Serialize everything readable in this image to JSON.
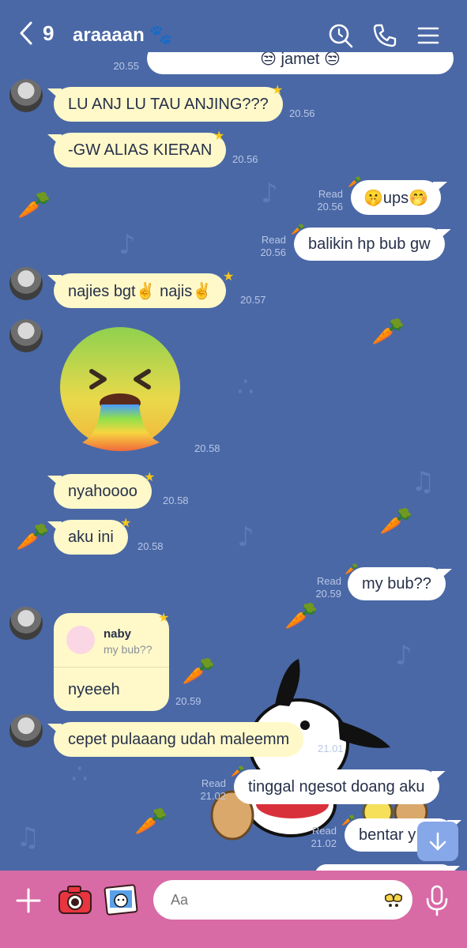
{
  "header": {
    "back_count": "9",
    "title": "araaaan",
    "title_emoji": "🐾"
  },
  "messages": [
    {
      "dir": "out",
      "text": "😒 jamet 😒",
      "time": "20.55",
      "partial": true
    },
    {
      "dir": "in",
      "text": "LU ANJ LU TAU ANJING???",
      "time": "20.56"
    },
    {
      "dir": "in",
      "text": "-GW ALIAS KIERAN",
      "time": "20.56"
    },
    {
      "dir": "out",
      "text": "🤫ups🤭",
      "read": "Read",
      "time": "20.56"
    },
    {
      "dir": "out",
      "text": "balikin hp bub gw",
      "read": "Read",
      "time": "20.56"
    },
    {
      "dir": "in",
      "text": "najies bgt✌️ najis✌️",
      "time": "20.57"
    },
    {
      "dir": "in",
      "type": "sticker",
      "sticker": "vomiting-face",
      "time": "20.58"
    },
    {
      "dir": "in",
      "text": "nyahoooo",
      "time": "20.58"
    },
    {
      "dir": "in",
      "text": "aku ini",
      "time": "20.58"
    },
    {
      "dir": "out",
      "text": "my bub??",
      "read": "Read",
      "time": "20.59"
    },
    {
      "dir": "in",
      "type": "reply",
      "quote_name": "naby",
      "quote_text": "my bub??",
      "text": "nyeeeh",
      "time": "20.59"
    },
    {
      "dir": "in",
      "text": "cepet pulaaang udah maleemm",
      "time": "21.01"
    },
    {
      "dir": "out",
      "text": "tinggal ngesot doang aku",
      "read": "Read",
      "time": "21.02"
    },
    {
      "dir": "out",
      "text": "bentar y",
      "read": "Read",
      "time": "21.02"
    }
  ],
  "composer": {
    "placeholder": "Aa"
  },
  "colors": {
    "background": "#4a68a6",
    "incoming_bubble": "#fff9c9",
    "outgoing_bubble": "#ffffff",
    "composer_bar": "#d86aa6",
    "scroll_button": "#86a8e8"
  }
}
